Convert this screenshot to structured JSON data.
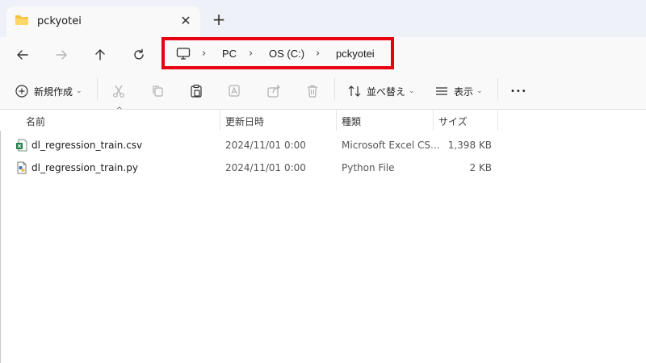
{
  "window": {
    "tab_title": "pckyotei",
    "close_glyph": "✕",
    "newtab_glyph": "+"
  },
  "nav": {
    "back": "arrow-left-icon",
    "forward": "arrow-right-icon",
    "up": "arrow-up-icon",
    "refresh": "refresh-icon"
  },
  "address": {
    "crumbs": [
      "PC",
      "OS (C:)",
      "pckyotei"
    ],
    "separator": "›",
    "highlight_color": "#e60012"
  },
  "toolbar": {
    "new_label": "新規作成",
    "sort_label": "並べ替え",
    "view_label": "表示",
    "more_glyph": "•••",
    "caret_glyph": "⌄"
  },
  "columns": {
    "name": "名前",
    "date": "更新日時",
    "type": "種類",
    "size": "サイズ",
    "sort_glyph": "^"
  },
  "files": [
    {
      "name": "dl_regression_train.csv",
      "date": "2024/11/01 0:00",
      "type": "Microsoft Excel CS...",
      "size": "1,398 KB",
      "icon": "excel-csv-icon"
    },
    {
      "name": "dl_regression_train.py",
      "date": "2024/11/01 0:00",
      "type": "Python File",
      "size": "2 KB",
      "icon": "python-file-icon"
    }
  ]
}
